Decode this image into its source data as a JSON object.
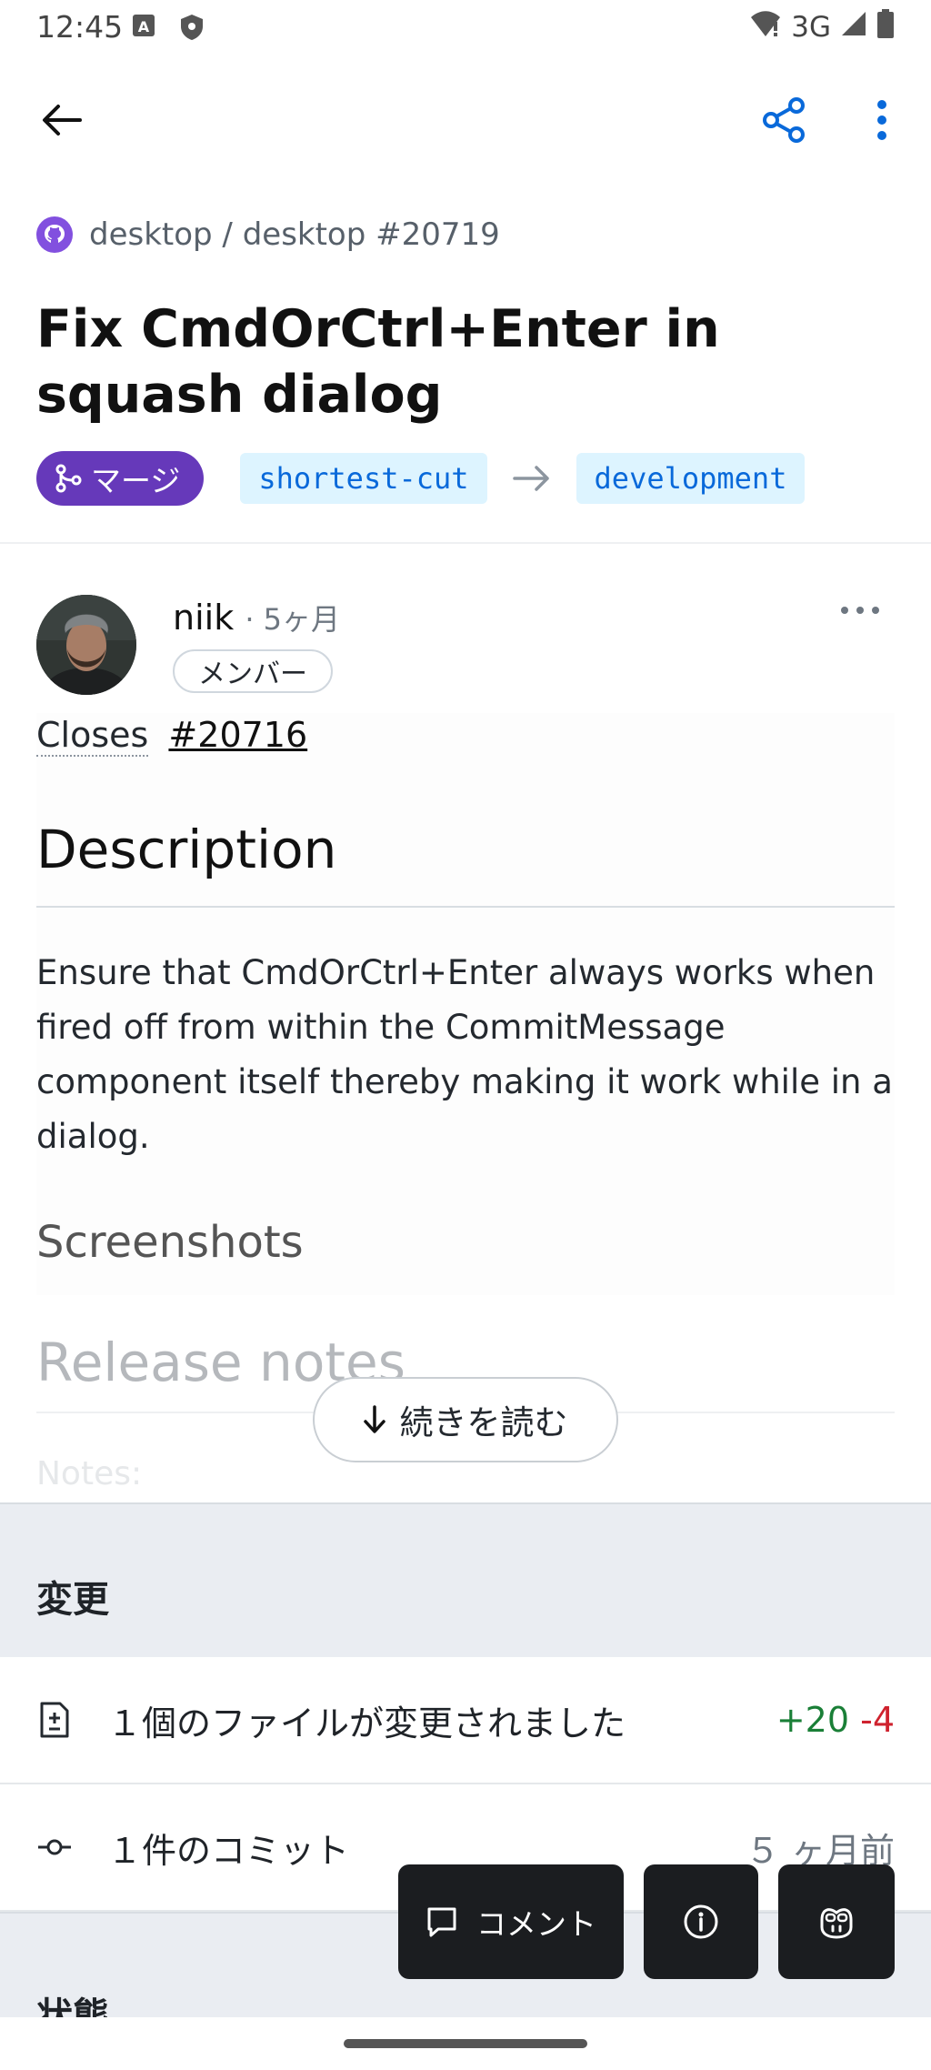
{
  "status_bar": {
    "time": "12:45",
    "network": "3G",
    "icons": [
      "a-badge-icon",
      "shield-icon",
      "wifi-icon",
      "signal-icon",
      "battery-icon"
    ]
  },
  "app_bar": {
    "icons": [
      "back-arrow-icon",
      "share-icon",
      "more-vert-icon"
    ]
  },
  "repo": {
    "path": "desktop / desktop #20719",
    "icon": "github-logo-icon"
  },
  "pr": {
    "title": "Fix CmdOrCtrl+Enter in squash dialog",
    "state_label": "マージ",
    "head_branch": "shortest-cut",
    "base_branch": "development"
  },
  "comment": {
    "author": "niik",
    "time": "· 5ヶ月",
    "role": "メンバー",
    "closes_label": "Closes",
    "closes_ref": "#20716",
    "heading_description": "Description",
    "description": "Ensure that CmdOrCtrl+Enter always works when fired off from within the CommitMessage component itself thereby making it work while in a dialog.",
    "heading_screenshots": "Screenshots",
    "heading_release": "Release notes",
    "notes_label": "Notes:",
    "read_more": "続きを読む"
  },
  "changes": {
    "section_title": "変更",
    "files_label": "１個のファイルが変更されました",
    "additions": "+20",
    "deletions": "-4",
    "commits_label": "１件のコミット",
    "commits_time": "５ ヶ月前"
  },
  "state": {
    "section_title": "状態"
  },
  "actions": {
    "comment_label": "コメント"
  },
  "colors": {
    "merged": "#6639ba",
    "branch_bg": "#ddf4ff",
    "branch_fg": "#0969da",
    "accent": "#0969da",
    "additions": "#1a7f37",
    "deletions": "#cf222e"
  }
}
